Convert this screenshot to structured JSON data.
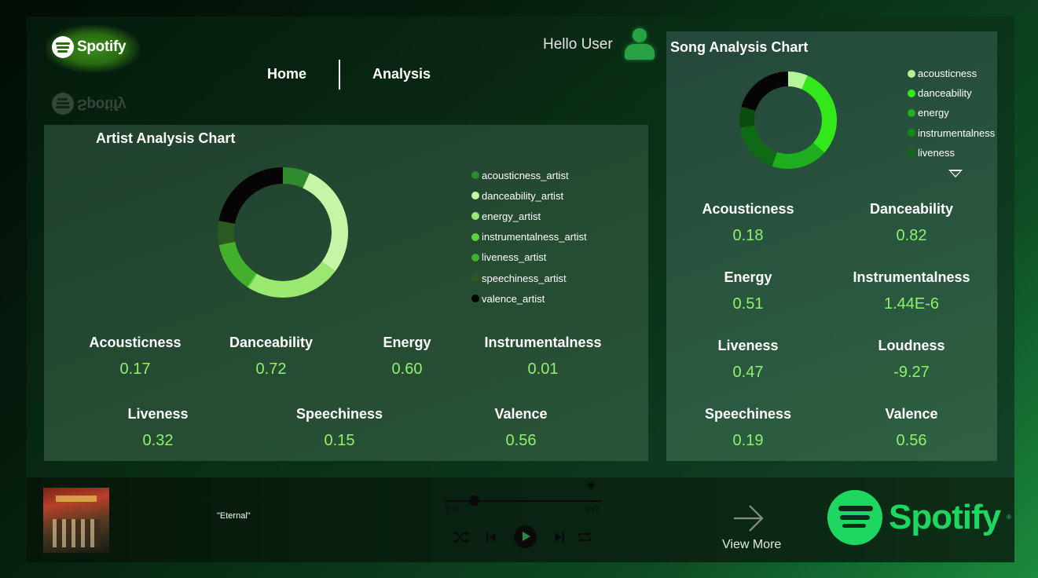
{
  "header": {
    "logo_text": "Spotify",
    "nav": {
      "home": "Home",
      "analysis": "Analysis"
    },
    "greeting": "Hello User"
  },
  "artist_panel": {
    "title": "Artist Analysis Chart",
    "legend": [
      {
        "label": "acousticness_artist",
        "color": "#2e8b2e"
      },
      {
        "label": "danceability_artist",
        "color": "#c6f5a6"
      },
      {
        "label": "energy_artist",
        "color": "#9ae870"
      },
      {
        "label": "instrumentalness_artist",
        "color": "#5ed43a"
      },
      {
        "label": "liveness_artist",
        "color": "#42b02a"
      },
      {
        "label": "speechiness_artist",
        "color": "#2a5a20"
      },
      {
        "label": "valence_artist",
        "color": "#050505"
      }
    ],
    "metrics_row1": [
      {
        "label": "Acousticness",
        "value": "0.17"
      },
      {
        "label": "Danceability",
        "value": "0.72"
      },
      {
        "label": "Energy",
        "value": "0.60"
      },
      {
        "label": "Instrumentalness",
        "value": "0.01"
      }
    ],
    "metrics_row2": [
      {
        "label": "Liveness",
        "value": "0.32"
      },
      {
        "label": "Speechiness",
        "value": "0.15"
      },
      {
        "label": "Valence",
        "value": "0.56"
      }
    ]
  },
  "song_panel": {
    "title": "Song Analysis Chart",
    "legend": [
      {
        "label": "acousticness",
        "color": "#b5f59a"
      },
      {
        "label": "danceability",
        "color": "#33e81a"
      },
      {
        "label": "energy",
        "color": "#1fae1f"
      },
      {
        "label": "instrumentalness",
        "color": "#138a1a"
      },
      {
        "label": "liveness",
        "color": "#0e6a14"
      }
    ],
    "metrics": [
      {
        "label": "Acousticness",
        "value": "0.18"
      },
      {
        "label": "Danceability",
        "value": "0.82"
      },
      {
        "label": "Energy",
        "value": "0.51"
      },
      {
        "label": "Instrumentalness",
        "value": "1.44E-6"
      },
      {
        "label": "Liveness",
        "value": "0.47"
      },
      {
        "label": "Loudness",
        "value": "-9.27"
      },
      {
        "label": "Speechiness",
        "value": "0.19"
      },
      {
        "label": "Valence",
        "value": "0.56"
      }
    ]
  },
  "chart_data": [
    {
      "type": "pie",
      "categories": [
        "acousticness_artist",
        "danceability_artist",
        "energy_artist",
        "instrumentalness_artist",
        "liveness_artist",
        "speechiness_artist",
        "valence_artist"
      ],
      "values": [
        0.17,
        0.72,
        0.6,
        0.01,
        0.32,
        0.15,
        0.56
      ],
      "colors": [
        "#2e8b2e",
        "#c6f5a6",
        "#9ae870",
        "#5ed43a",
        "#42b02a",
        "#2a5a20",
        "#050505"
      ]
    },
    {
      "type": "pie",
      "categories": [
        "acousticness",
        "danceability",
        "energy",
        "instrumentalness",
        "liveness",
        "speechiness",
        "valence"
      ],
      "values": [
        0.18,
        0.82,
        0.51,
        1.4e-06,
        0.47,
        0.19,
        0.56
      ],
      "colors": [
        "#b5f59a",
        "#33e81a",
        "#1fae1f",
        "#138a1a",
        "#0e6a14",
        "#0b4d10",
        "#050505"
      ]
    }
  ],
  "player": {
    "song_title": "\"Eternal\"",
    "current_time": "0:37",
    "duration": "3:17",
    "progress": 0.188,
    "view_more": "View More",
    "brand_text": "Spotify",
    "brand_reg": "®"
  }
}
